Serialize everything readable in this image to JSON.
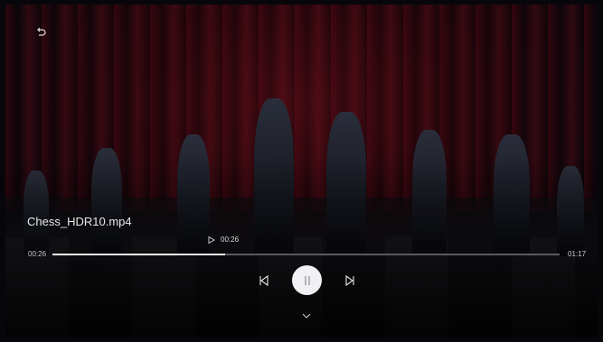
{
  "player": {
    "title": "Chess_HDR10.mp4",
    "current_time": "00:26",
    "total_time": "01:17",
    "hover_time": "00:26",
    "progress": 0.34,
    "state": "playing"
  },
  "icons": {
    "back": "back-arrow-icon",
    "play_marker": "play-triangle-icon",
    "previous": "skip-previous-icon",
    "pause": "pause-icon",
    "next": "skip-next-icon",
    "expand": "chevron-down-icon"
  },
  "colors": {
    "accent": "#f1f1f3",
    "track": "#5a5a60",
    "text": "#e8e8ea"
  }
}
